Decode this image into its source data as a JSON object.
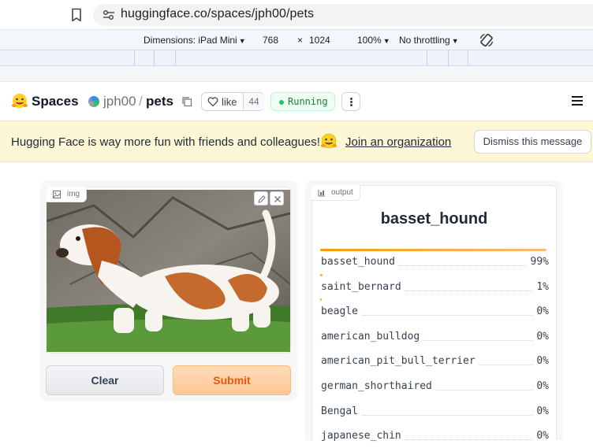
{
  "browser": {
    "url": "huggingface.co/spaces/jph00/pets"
  },
  "devtools": {
    "dimensions_label": "Dimensions: iPad Mini",
    "width": "768",
    "times": "×",
    "height": "1024",
    "zoom": "100%",
    "throttling": "No throttling"
  },
  "header": {
    "spaces_label": "Spaces",
    "owner": "jph00",
    "separator": "/",
    "repo": "pets",
    "like_label": "like",
    "like_count": "44",
    "status": "Running"
  },
  "banner": {
    "text": "Hugging Face is way more fun with friends and colleagues!",
    "link": "Join an organization",
    "dismiss": "Dismiss this message"
  },
  "input": {
    "label": "img",
    "clear": "Clear",
    "submit": "Submit"
  },
  "output": {
    "label": "output",
    "prediction": "basset_hound",
    "confidences": [
      {
        "label": "basset_hound",
        "value": 0.99,
        "display": "99%"
      },
      {
        "label": "saint_bernard",
        "value": 0.01,
        "display": "1%"
      },
      {
        "label": "beagle",
        "value": 0.002,
        "display": "0%"
      },
      {
        "label": "american_bulldog",
        "value": 0,
        "display": "0%"
      },
      {
        "label": "american_pit_bull_terrier",
        "value": 0,
        "display": "0%"
      },
      {
        "label": "german_shorthaired",
        "value": 0,
        "display": "0%"
      },
      {
        "label": "Bengal",
        "value": 0,
        "display": "0%"
      },
      {
        "label": "japanese_chin",
        "value": 0,
        "display": "0%"
      }
    ]
  },
  "colors": {
    "accent": "#f59e0b",
    "submit_text": "#ea580c",
    "banner_bg": "#fef7d6",
    "status_green": "#22c55e"
  },
  "icons": [
    "bookmark-icon",
    "site-settings-icon",
    "rotate-icon",
    "hugging-face-logo",
    "copy-icon",
    "heart-icon",
    "more-icon",
    "menu-icon",
    "image-icon",
    "edit-icon",
    "close-icon",
    "label-icon"
  ]
}
